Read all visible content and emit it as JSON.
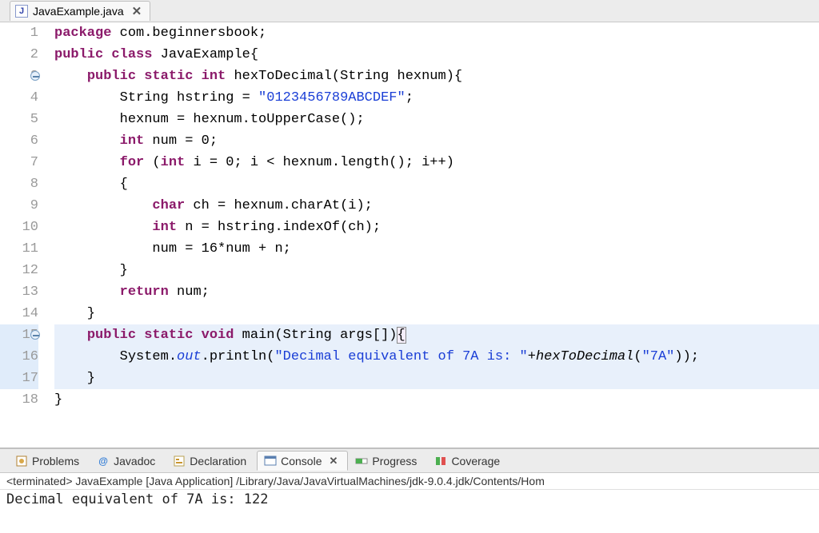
{
  "editor": {
    "tab_filename": "JavaExample.java",
    "close_glyph": "✕"
  },
  "code": {
    "lines": [
      {
        "n": "1",
        "fold": false,
        "hl": false
      },
      {
        "n": "2",
        "fold": false,
        "hl": false
      },
      {
        "n": "3",
        "fold": true,
        "hl": false
      },
      {
        "n": "4",
        "fold": false,
        "hl": false
      },
      {
        "n": "5",
        "fold": false,
        "hl": false
      },
      {
        "n": "6",
        "fold": false,
        "hl": false
      },
      {
        "n": "7",
        "fold": false,
        "hl": false
      },
      {
        "n": "8",
        "fold": false,
        "hl": false
      },
      {
        "n": "9",
        "fold": false,
        "hl": false
      },
      {
        "n": "10",
        "fold": false,
        "hl": false
      },
      {
        "n": "11",
        "fold": false,
        "hl": false
      },
      {
        "n": "12",
        "fold": false,
        "hl": false
      },
      {
        "n": "13",
        "fold": false,
        "hl": false
      },
      {
        "n": "14",
        "fold": false,
        "hl": false
      },
      {
        "n": "15",
        "fold": true,
        "hl": true
      },
      {
        "n": "16",
        "fold": false,
        "hl": true
      },
      {
        "n": "17",
        "fold": false,
        "hl": true
      },
      {
        "n": "18",
        "fold": false,
        "hl": false
      }
    ],
    "tokens": {
      "package": "package",
      "pkgname": "com.beginnersbook",
      "public": "public",
      "class": "class",
      "classname": "JavaExample",
      "static": "static",
      "int": "int",
      "void": "void",
      "char": "char",
      "for": "for",
      "return": "return",
      "hexToDecimal": "hexToDecimal",
      "String": "String",
      "hexnum": "hexnum",
      "hstring": "hstring",
      "hexlit": "\"0123456789ABCDEF\"",
      "toUpperCase": "toUpperCase",
      "num": "num",
      "zero": "0",
      "i": "i",
      "length": "length",
      "ch": "ch",
      "charAt": "charAt",
      "n": "n",
      "indexOf": "indexOf",
      "sixteen": "16",
      "main": "main",
      "args": "args",
      "System": "System",
      "out": "out",
      "println": "println",
      "printstr": "\"Decimal equivalent of 7A is: \"",
      "arg7a": "\"7A\""
    }
  },
  "views": {
    "problems": "Problems",
    "javadoc": "Javadoc",
    "declaration": "Declaration",
    "console": "Console",
    "progress": "Progress",
    "coverage": "Coverage",
    "javadoc_at": "@"
  },
  "console": {
    "status": "<terminated> JavaExample [Java Application] /Library/Java/JavaVirtualMachines/jdk-9.0.4.jdk/Contents/Hom",
    "output": "Decimal equivalent of 7A is: 122"
  }
}
